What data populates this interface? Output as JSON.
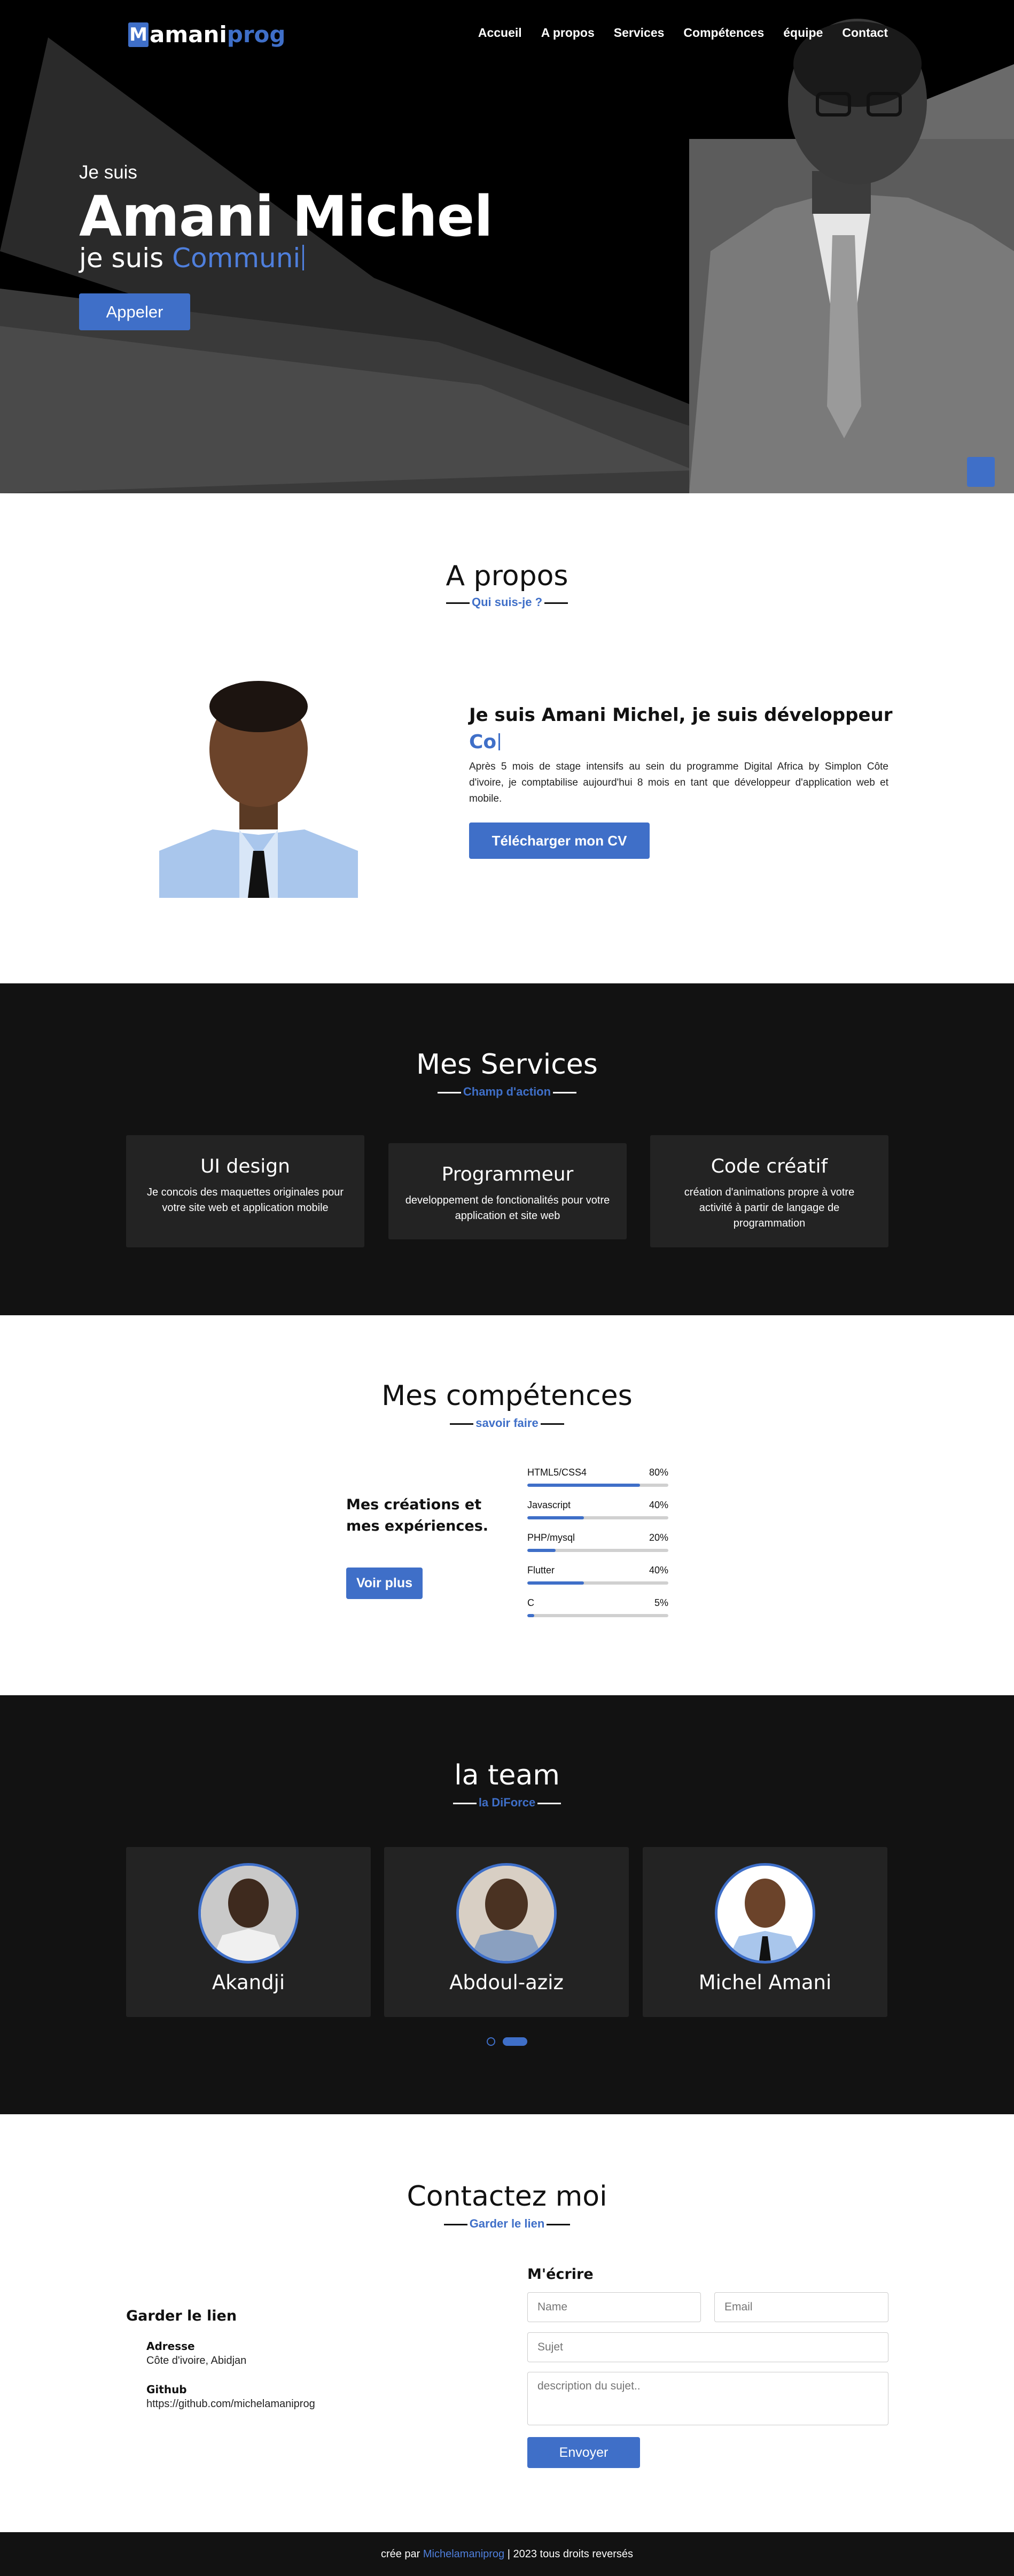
{
  "logo": {
    "letter": "M",
    "part1": "amani",
    "part2": "prog"
  },
  "nav": [
    "Accueil",
    "A propos",
    "Services",
    "Compétences",
    "équipe",
    "Contact"
  ],
  "hero": {
    "greeting": "Je suis",
    "name": "Amani Michel",
    "role_prefix": "je suis ",
    "role_typed": "Communi",
    "button": "Appeler"
  },
  "about": {
    "title": "A propos",
    "subtitle": "Qui suis-je ?",
    "heading": "Je suis Amani Michel, je suis développeur",
    "typed": "Co",
    "text": "Après 5 mois de stage intensifs au sein du programme Digital Africa by Simplon Côte d'ivoire, je comptabilise aujourd'hui 8 mois en tant que développeur d'application web et mobile.",
    "button": "Télécharger mon CV"
  },
  "services": {
    "title": "Mes Services",
    "subtitle": "Champ d'action",
    "cards": [
      {
        "title": "UI design",
        "desc": "Je concois des maquettes originales pour votre site web et application mobile"
      },
      {
        "title": "Programmeur",
        "desc": "developpement de fonctionalités pour votre application et site web"
      },
      {
        "title": "Code créatif",
        "desc": "création d'animations propre à votre activité à partir de langage de programmation"
      }
    ]
  },
  "skills": {
    "title": "Mes compétences",
    "subtitle": "savoir faire",
    "left_line1": "Mes créations et",
    "left_line2": "mes expériences.",
    "button": "Voir plus",
    "items": [
      {
        "name": "HTML5/CSS4",
        "percent": "80%",
        "value": 0.8
      },
      {
        "name": "Javascript",
        "percent": "40%",
        "value": 0.4
      },
      {
        "name": "PHP/mysql",
        "percent": "20%",
        "value": 0.2
      },
      {
        "name": "Flutter",
        "percent": "40%",
        "value": 0.4
      },
      {
        "name": "C",
        "percent": "5%",
        "value": 0.05
      }
    ]
  },
  "team": {
    "title": "la team",
    "subtitle": "la DiForce",
    "members": [
      "Akandji",
      "Abdoul-aziz",
      "Michel Amani"
    ]
  },
  "contact": {
    "title": "Contactez moi",
    "subtitle": "Garder le lien",
    "left_title": "Garder le lien",
    "address_label": "Adresse",
    "address_value": "Côte d'ivoire, Abidjan",
    "github_label": "Github",
    "github_value": "https://github.com/michelamaniprog",
    "form_title": "M'écrire",
    "name_ph": "Name",
    "email_ph": "Email",
    "subject_ph": "Sujet",
    "desc_ph": "description du sujet..",
    "send": "Envoyer"
  },
  "footer": {
    "prefix": "crée par ",
    "link": "Michelamaniprog",
    "suffix": " | 2023 tous droits reversés"
  },
  "colors": {
    "accent": "#3f6fc8",
    "dark": "#121212",
    "card": "#232323"
  }
}
